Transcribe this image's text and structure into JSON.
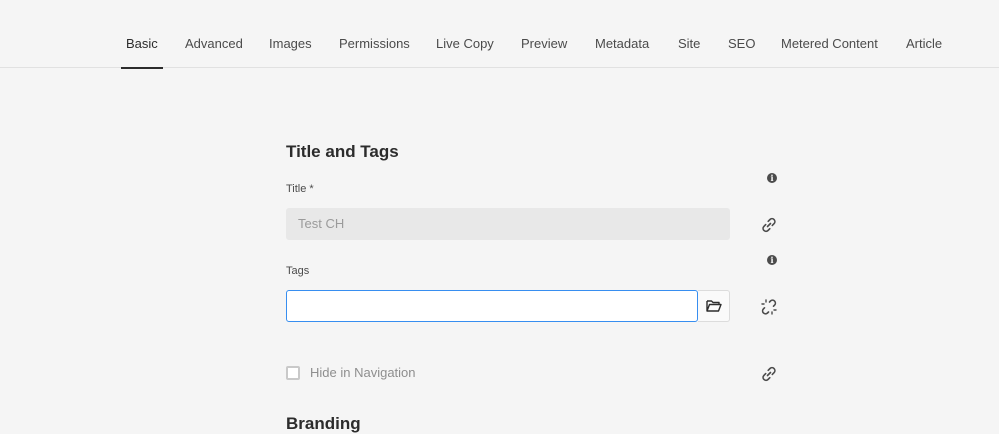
{
  "tabs": [
    {
      "label": "Basic",
      "active": true
    },
    {
      "label": "Advanced"
    },
    {
      "label": "Images"
    },
    {
      "label": "Permissions"
    },
    {
      "label": "Live Copy"
    },
    {
      "label": "Preview"
    },
    {
      "label": "Metadata"
    },
    {
      "label": "Site"
    },
    {
      "label": "SEO"
    },
    {
      "label": "Metered Content"
    },
    {
      "label": "Article"
    }
  ],
  "section_title_tags": "Title and Tags",
  "title_field": {
    "label": "Title *",
    "value": "Test CH",
    "disabled": true
  },
  "tags_field": {
    "label": "Tags",
    "value": "",
    "focused": true
  },
  "hide_in_navigation": {
    "label": "Hide in Navigation",
    "checked": false,
    "disabled": true
  },
  "section_branding": "Branding",
  "icons": {
    "info": "info-icon",
    "link": "link-icon",
    "broken_link": "broken-link-icon",
    "folder": "folder-icon"
  },
  "colors": {
    "accent": "#378ef0",
    "background": "#f5f5f5"
  }
}
